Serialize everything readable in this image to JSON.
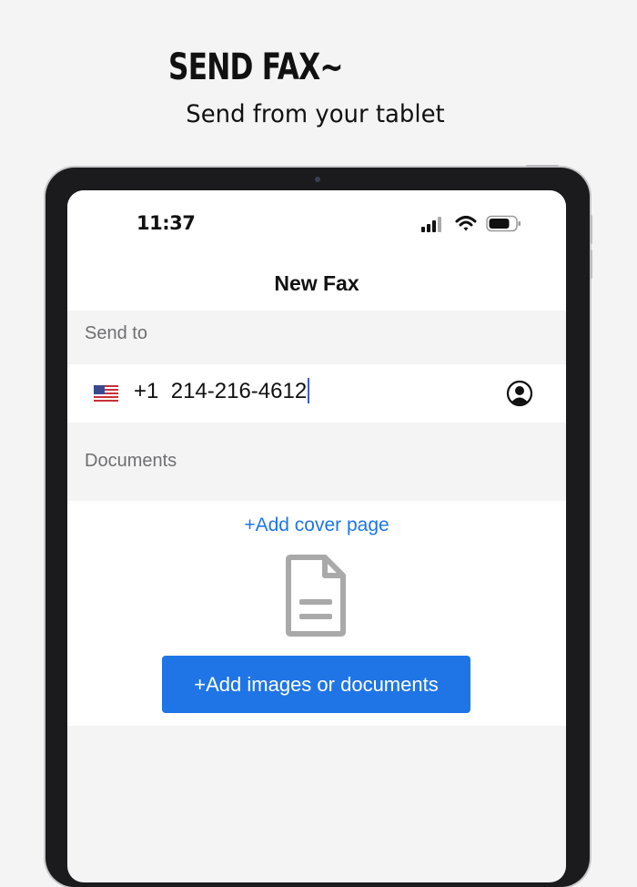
{
  "promo": {
    "headline": "SEND FAX~",
    "subhead": "Send from your tablet"
  },
  "status_bar": {
    "time": "11:37",
    "icons": [
      "cellular-signal-icon",
      "wifi-icon",
      "battery-icon"
    ]
  },
  "nav": {
    "title": "New Fax"
  },
  "send_to": {
    "label": "Send to",
    "country_flag": "us-flag-icon",
    "country_code": "+1",
    "phone_number": "214-216-4612",
    "contact_icon": "contact-icon"
  },
  "documents": {
    "label": "Documents",
    "add_cover_label": "+Add cover page",
    "placeholder_icon": "document-icon",
    "add_button_label": "+Add images or documents"
  },
  "colors": {
    "accent": "#1f75e6",
    "link": "#1d76e6",
    "section_bg": "#f4f4f4",
    "page_bg": "#f5f4f5"
  }
}
